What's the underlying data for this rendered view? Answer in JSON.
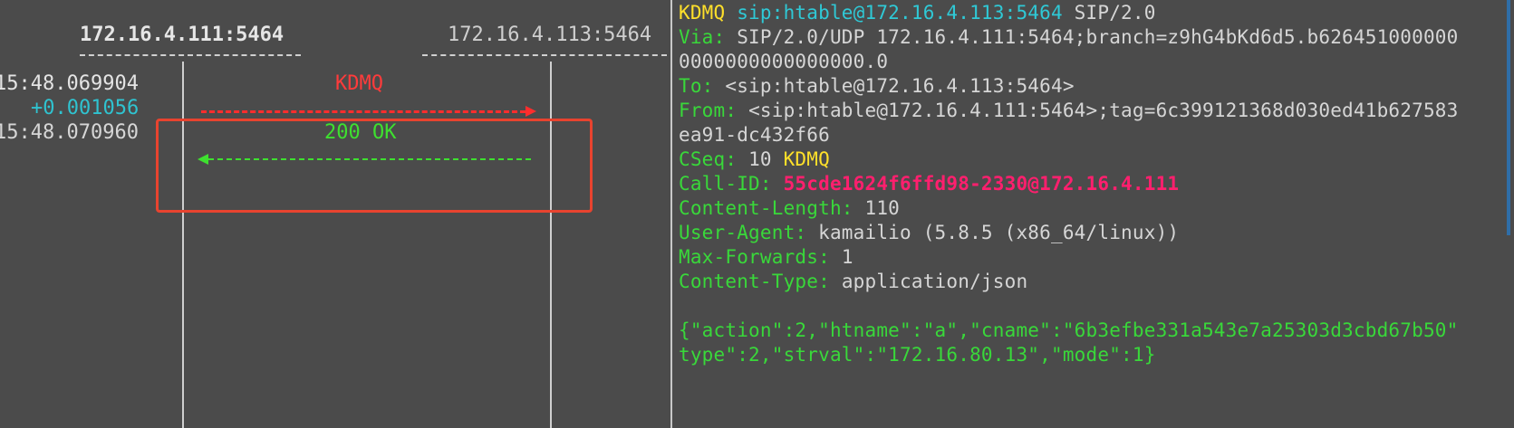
{
  "flow": {
    "host_a": "172.16.4.111:5464",
    "host_b": "172.16.4.113:5464",
    "timestamps": [
      "15:48.069904",
      "+0.001056",
      "15:48.070960"
    ],
    "messages": [
      {
        "label": "KDMQ",
        "direction": "right",
        "color": "#ff2d2d"
      },
      {
        "label": "200 OK",
        "direction": "left",
        "color": "#3ee02f"
      }
    ]
  },
  "detail": {
    "request_line": {
      "method": "KDMQ",
      "uri": "sip:htable@172.16.4.113:5464",
      "version": "SIP/2.0"
    },
    "via": {
      "key": "Via:",
      "value1": "SIP/2.0/UDP 172.16.4.111:5464;branch=z9hG4bKd6d5.b626451000000",
      "value2": "0000000000000000.0"
    },
    "to": {
      "key": "To:",
      "value": "<sip:htable@172.16.4.113:5464>"
    },
    "from": {
      "key": "From:",
      "value1": "<sip:htable@172.16.4.111:5464>;tag=6c399121368d030ed41b627583",
      "value2": "ea91-dc432f66"
    },
    "cseq": {
      "key": "CSeq:",
      "number": "10",
      "method": "KDMQ"
    },
    "call_id": {
      "key": "Call-ID:",
      "value": "55cde1624f6ffd98-2330@172.16.4.111"
    },
    "content_length": {
      "key": "Content-Length:",
      "value": "110"
    },
    "user_agent": {
      "key": "User-Agent:",
      "value": "kamailio (5.8.5 (x86_64/linux))"
    },
    "max_forwards": {
      "key": "Max-Forwards:",
      "value": "1"
    },
    "content_type": {
      "key": "Content-Type:",
      "value": "application/json"
    },
    "body": {
      "line1": "{\"action\":2,\"htname\":\"a\",\"cname\":\"6b3efbe331a543e7a25303d3cbd67b50\"",
      "line2": "type\":2,\"strval\":\"172.16.80.13\",\"mode\":1}"
    }
  },
  "colors": {
    "background": "#4b4b4b",
    "method": "#ffe02a",
    "header_key": "#39d83a",
    "uri": "#2fc9d6",
    "call_id": "#ff1f6e",
    "highlight": "#e8432f"
  }
}
